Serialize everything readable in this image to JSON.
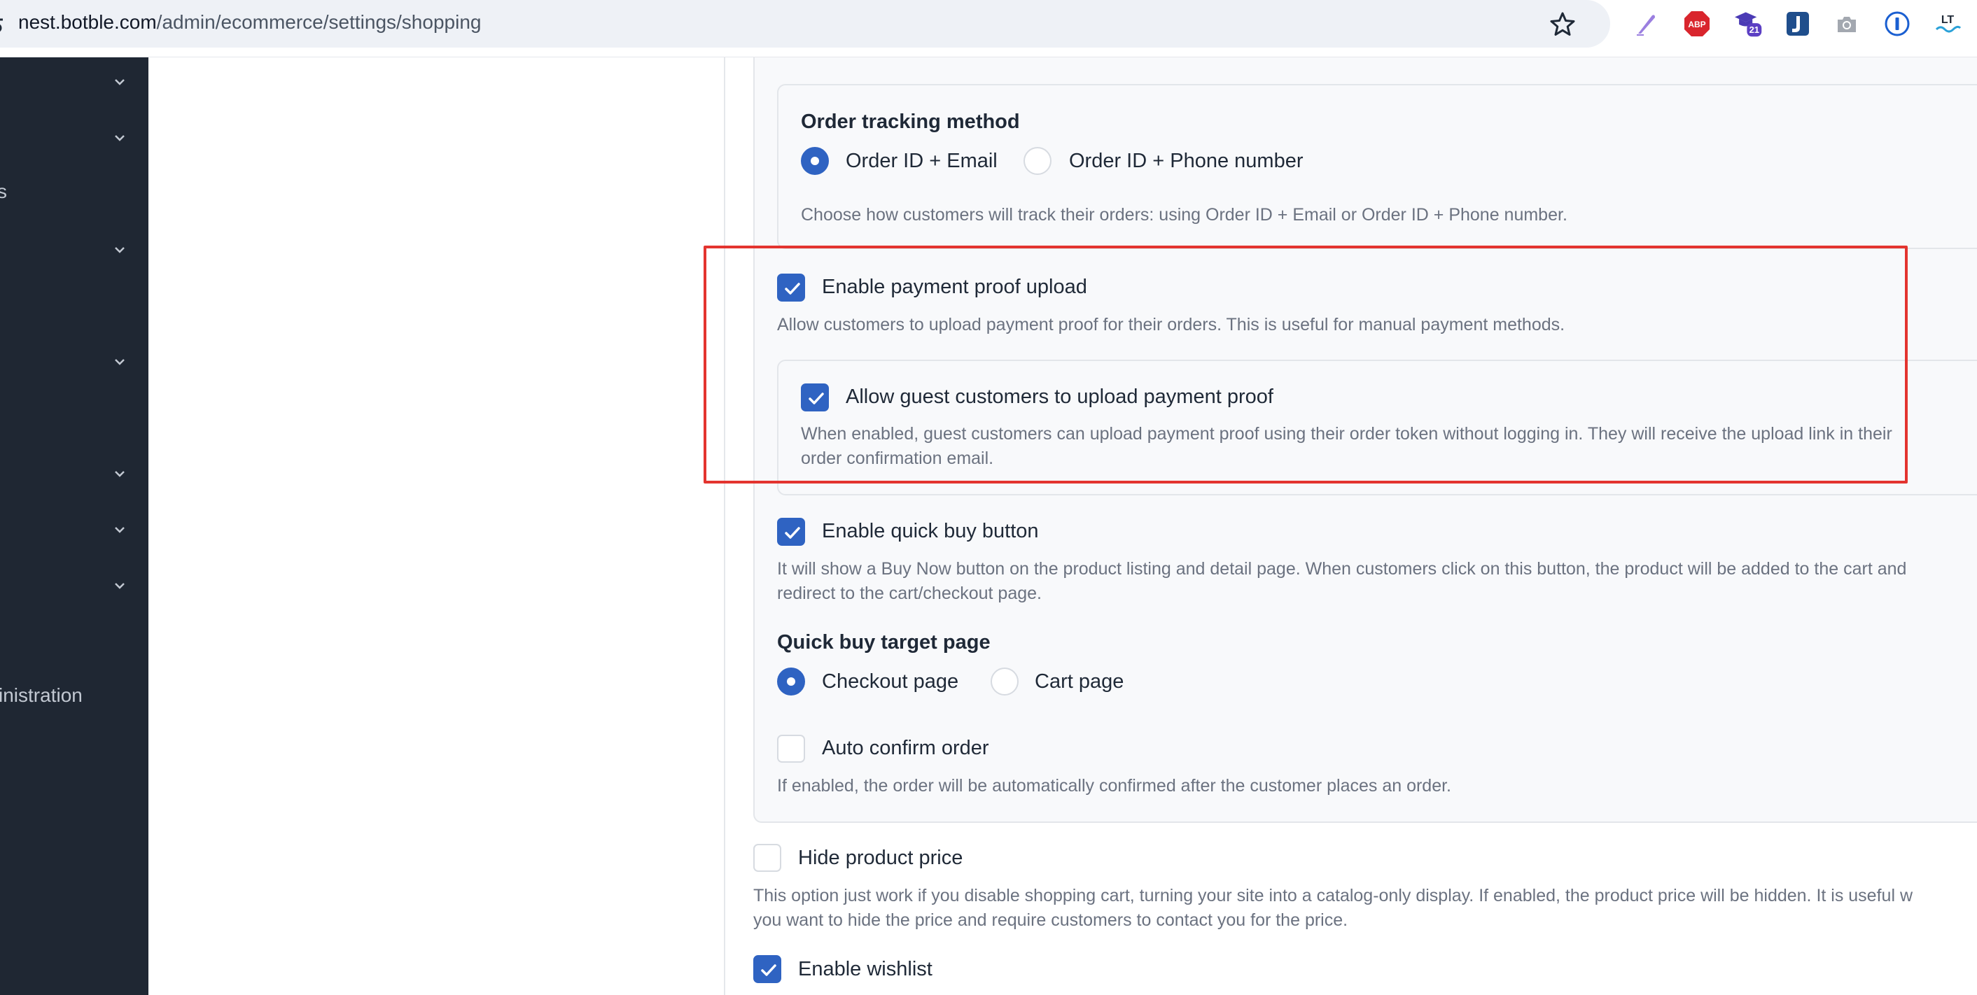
{
  "browser": {
    "url_host": "nest.botble.com",
    "url_path": "/admin/ecommerce/settings/shopping",
    "extensions": [
      {
        "icon": "pen-extension-icon"
      },
      {
        "icon": "adblock-plus-icon",
        "label": "ABP"
      },
      {
        "icon": "graduation-cap-extension-icon",
        "badge": "21"
      },
      {
        "icon": "jira-extension-icon"
      },
      {
        "icon": "camera-extension-icon"
      },
      {
        "icon": "password-manager-icon"
      },
      {
        "icon": "languagetool-icon",
        "label": "LT"
      }
    ]
  },
  "sidebar": {
    "fragment_s": "s",
    "fragment_administration": "inistration"
  },
  "settings": {
    "order_tracking": {
      "title": "Order tracking method",
      "options": [
        "Order ID + Email",
        "Order ID + Phone number"
      ],
      "selected": "Order ID + Email",
      "help": "Choose how customers will track their orders: using Order ID + Email or Order ID + Phone number."
    },
    "payment_proof": {
      "label": "Enable payment proof upload",
      "checked": true,
      "help": "Allow customers to upload payment proof for their orders. This is useful for manual payment methods."
    },
    "guest_payment_proof": {
      "label": "Allow guest customers to upload payment proof",
      "checked": true,
      "help_line1": "When enabled, guest customers can upload payment proof using their order token without logging in. They will receive the upload link in their",
      "help_line2": "order confirmation email."
    },
    "quick_buy": {
      "label": "Enable quick buy button",
      "checked": true,
      "help_line1": "It will show a Buy Now button on the product listing and detail page. When customers click on this button, the product will be added to the cart and",
      "help_line2": "redirect to the cart/checkout page."
    },
    "quick_buy_target": {
      "title": "Quick buy target page",
      "options": [
        "Checkout page",
        "Cart page"
      ],
      "selected": "Checkout page"
    },
    "auto_confirm": {
      "label": "Auto confirm order",
      "checked": false,
      "help": "If enabled, the order will be automatically confirmed after the customer places an order."
    },
    "hide_price": {
      "label": "Hide product price",
      "checked": false,
      "help_line1": "This option just work if you disable shopping cart, turning your site into a catalog-only display. If enabled, the product price will be hidden. It is useful w",
      "help_line2": "you want to hide the price and require customers to contact you for the price."
    },
    "wishlist": {
      "label": "Enable wishlist",
      "checked": true
    }
  },
  "colors": {
    "accent": "#2f63c2",
    "sidebar_bg": "#1f2733",
    "highlight": "#e3342f"
  }
}
